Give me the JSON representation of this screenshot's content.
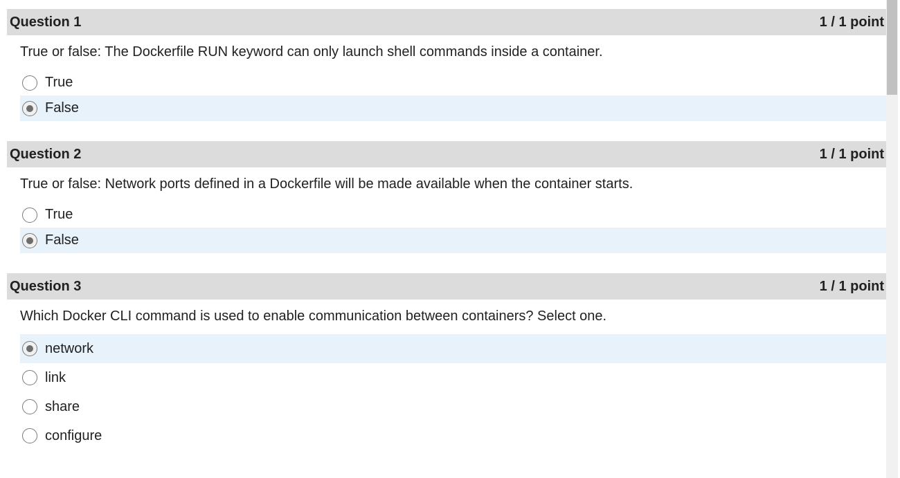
{
  "questions": [
    {
      "title": "Question 1",
      "points": "1 / 1 point",
      "prompt": "True or false: The Dockerfile RUN keyword can only launch shell commands inside a container.",
      "options": [
        {
          "label": "True",
          "selected": false
        },
        {
          "label": "False",
          "selected": true
        }
      ]
    },
    {
      "title": "Question 2",
      "points": "1 / 1 point",
      "prompt": "True or false: Network ports defined in a Dockerfile will be made available when the container starts.",
      "options": [
        {
          "label": "True",
          "selected": false
        },
        {
          "label": "False",
          "selected": true
        }
      ]
    },
    {
      "title": "Question 3",
      "points": "1 / 1 point",
      "prompt": "Which Docker CLI command is used to enable communication between containers? Select one.",
      "options": [
        {
          "label": "network",
          "selected": true
        },
        {
          "label": "link",
          "selected": false
        },
        {
          "label": "share",
          "selected": false
        },
        {
          "label": "configure",
          "selected": false
        }
      ]
    }
  ],
  "colors": {
    "header_bg": "#dcdcdc",
    "selected_bg": "#e8f2fb",
    "text": "#202122"
  }
}
